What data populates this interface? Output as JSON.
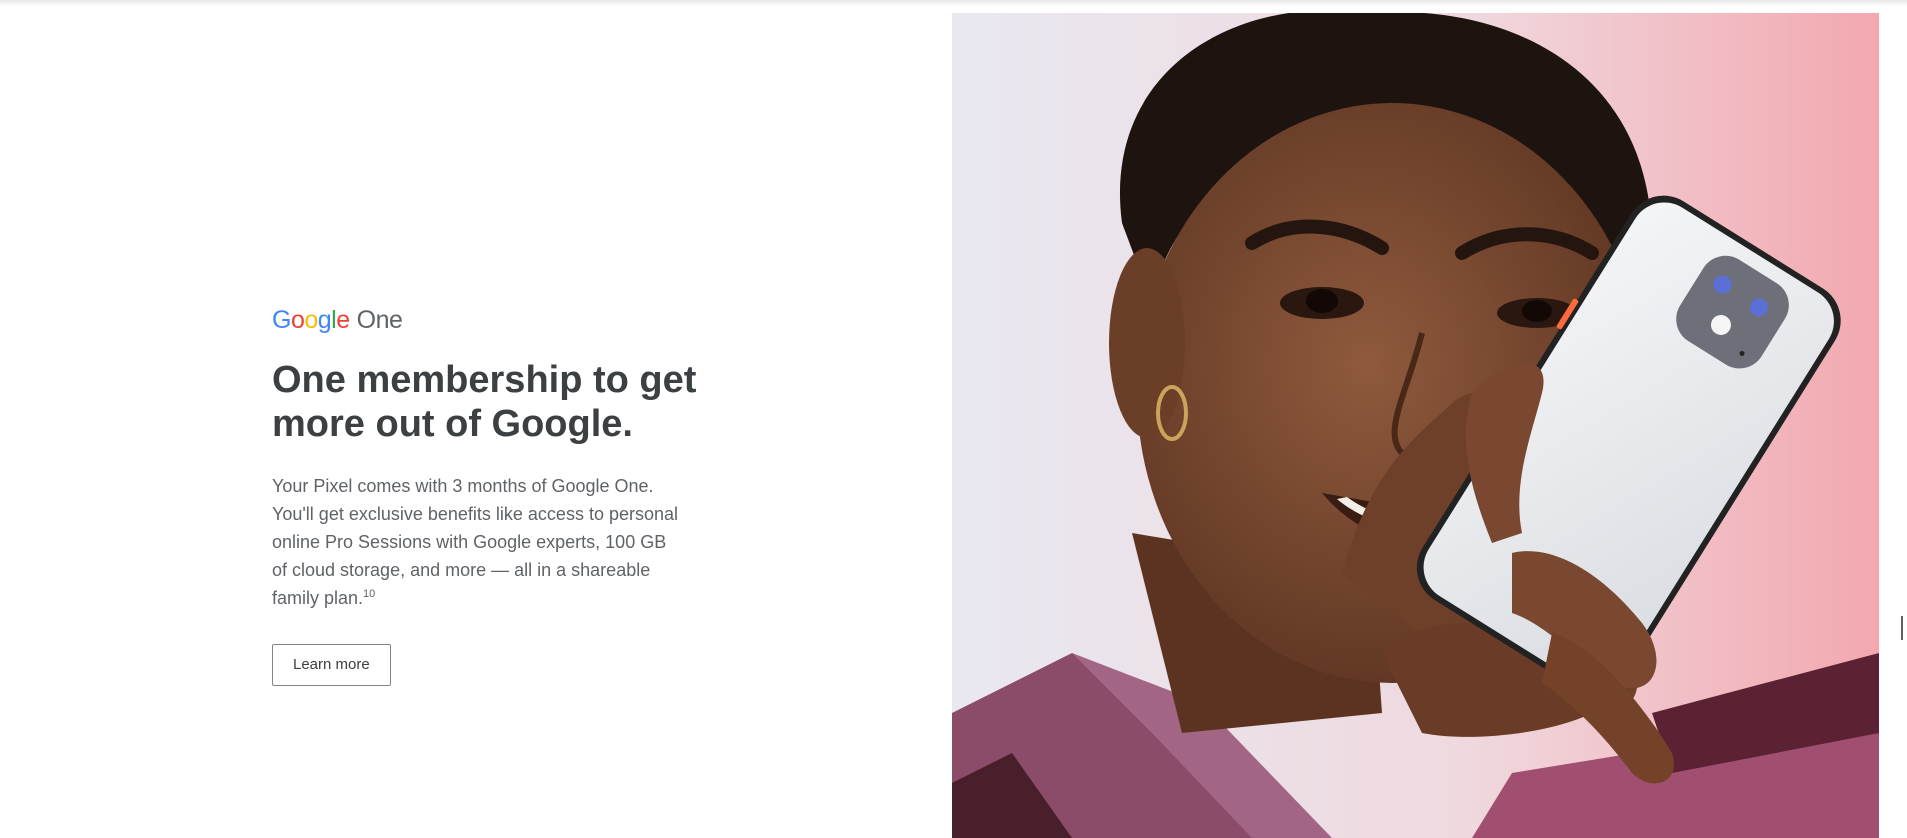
{
  "logo": {
    "brand_letters": [
      "G",
      "o",
      "o",
      "g",
      "l",
      "e"
    ],
    "product": "One"
  },
  "headline": {
    "line1": "One membership to get",
    "line2": "more out of Google."
  },
  "body": {
    "lines": [
      "Your Pixel comes with 3 months of Google One.",
      "You'll get exclusive benefits like access to personal",
      "online Pro Sessions with Google experts, 100 GB",
      "of cloud storage, and more — all in a shareable"
    ],
    "last_line": "family plan.",
    "footnote": "10"
  },
  "cta": {
    "label": "Learn more"
  },
  "hero_image": {
    "icon": "woman-holding-pixel-phone-photo",
    "colors": {
      "bg_left": "#e8e7f0",
      "bg_right": "#f2a7ad",
      "skin": "#7a4a32",
      "hair": "#1e140f",
      "shirt": "#8a4c68",
      "phone": "#eef0f3",
      "camera": "#6d7078"
    }
  }
}
